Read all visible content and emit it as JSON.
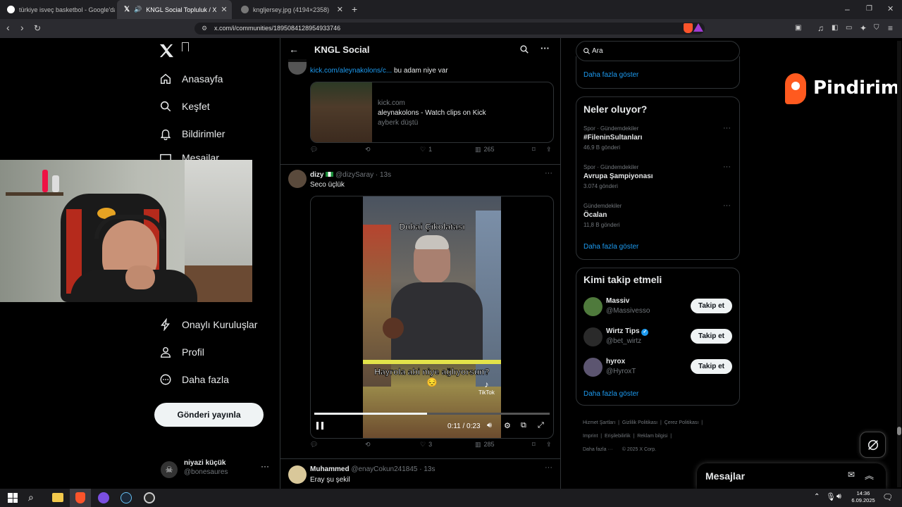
{
  "browser": {
    "tabs": [
      {
        "label": "türkiye isveç basketbol - Google'da A"
      },
      {
        "label": "KNGL Social Topluluk / X"
      },
      {
        "label": "kngljersey.jpg (4194×2358)"
      }
    ],
    "url": "x.com/i/communities/1895084128954933746"
  },
  "nav": {
    "home": "Anasayfa",
    "explore": "Keşfet",
    "notifications": "Bildirimler",
    "messages_partial": "Mesajlar",
    "verified_orgs": "Onaylı Kuruluşlar",
    "profile": "Profil",
    "more": "Daha fazla",
    "post_button": "Gönderi yayınla",
    "account": {
      "name": "niyazi küçük",
      "handle": "@bonesaures"
    }
  },
  "feed": {
    "title": "KNGL Social",
    "post1": {
      "text_link": "kick.com/aleynakolons/c...",
      "text_rest": " bu adam niye var",
      "card": {
        "domain": "kick.com",
        "title": "aleynakolons - Watch clips on Kick",
        "subtitle": "ayberk düştü"
      },
      "likes": "1",
      "views": "265"
    },
    "post2": {
      "name": "dizy",
      "handle": "@dizySaray",
      "time": "· 13s",
      "text": "Seco üçlük",
      "video_top_caption": "Dubai Çikolatası",
      "video_bottom_caption": "Hayrola abi niye ağlıyorsun?😔",
      "tiktok_label": "TikTok",
      "time_display": "0:11 / 0:23",
      "progress": 0.478,
      "likes": "3",
      "views": "285"
    },
    "post3": {
      "name": "Muhammed",
      "handle": "@enayCokun241845",
      "time": "· 13s",
      "text": "Eray şu şekil"
    }
  },
  "sidebar": {
    "search_placeholder": "Ara",
    "show_more_top": "Daha fazla göster",
    "whats_happening": "Neler oluyor?",
    "trends": [
      {
        "category": "Spor · Gündemdekiler",
        "name": "#FileninSultanları",
        "count": "46,9 B gönderi"
      },
      {
        "category": "Spor · Gündemdekiler",
        "name": "Avrupa Şampiyonası",
        "count": "3.074 gönderi"
      },
      {
        "category": "Gündemdekiler",
        "name": "Öcalan",
        "count": "11,8 B gönderi"
      }
    ],
    "show_more_trends": "Daha fazla göster",
    "who_to_follow": "Kimi takip etmeli",
    "follow": [
      {
        "name": "Massiv",
        "handle": "@Massivesso",
        "button": "Takip et"
      },
      {
        "name": "Wirtz Tips",
        "handle": "@bet_wirtz",
        "button": "Takip et"
      },
      {
        "name": "hyrox",
        "handle": "@HyroxT",
        "button": "Takip et"
      }
    ],
    "show_more_follow": "Daha fazla göster",
    "footer": [
      "Hizmet Şartları",
      "Gizlilik Politikası",
      "Çerez Politikası",
      "Imprint",
      "Erişilebilirlik",
      "Reklam bilgisi",
      "Daha fazla ···",
      "© 2025 X Corp."
    ],
    "messages_drawer": "Mesajlar"
  },
  "overlay": {
    "brand": "Pindirim"
  },
  "taskbar": {
    "time": "14:36",
    "date": "6.09.2025"
  },
  "colors": {
    "accent": "#1d9bf0",
    "brand_orange": "#ff5a1f",
    "bg": "#000000"
  }
}
